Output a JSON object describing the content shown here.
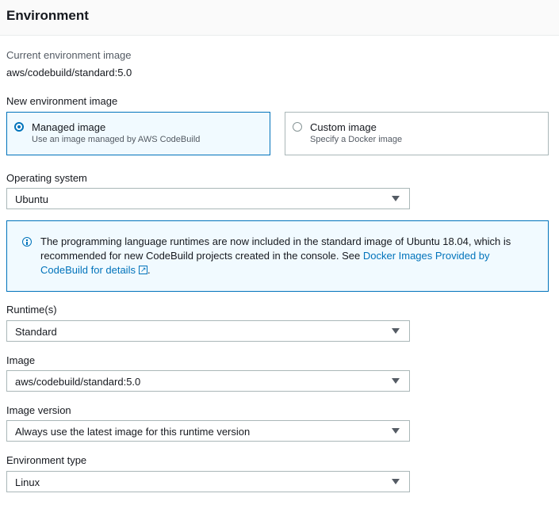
{
  "section": {
    "title": "Environment"
  },
  "current_image": {
    "label": "Current environment image",
    "value": "aws/codebuild/standard:5.0"
  },
  "new_image": {
    "label": "New environment image",
    "options": [
      {
        "title": "Managed image",
        "description": "Use an image managed by AWS CodeBuild",
        "selected": true
      },
      {
        "title": "Custom image",
        "description": "Specify a Docker image",
        "selected": false
      }
    ]
  },
  "operating_system": {
    "label": "Operating system",
    "value": "Ubuntu"
  },
  "info": {
    "text": "The programming language runtimes are now included in the standard image of Ubuntu 18.04, which is recommended for new CodeBuild projects created in the console. See ",
    "link": "Docker Images Provided by CodeBuild for details",
    "suffix": ".",
    "icon": "info-circle-icon",
    "color": "#0073bb"
  },
  "runtime": {
    "label": "Runtime(s)",
    "value": "Standard"
  },
  "image": {
    "label": "Image",
    "value": "aws/codebuild/standard:5.0"
  },
  "image_version": {
    "label": "Image version",
    "value": "Always use the latest image for this runtime version"
  },
  "environment_type": {
    "label": "Environment type",
    "value": "Linux"
  }
}
